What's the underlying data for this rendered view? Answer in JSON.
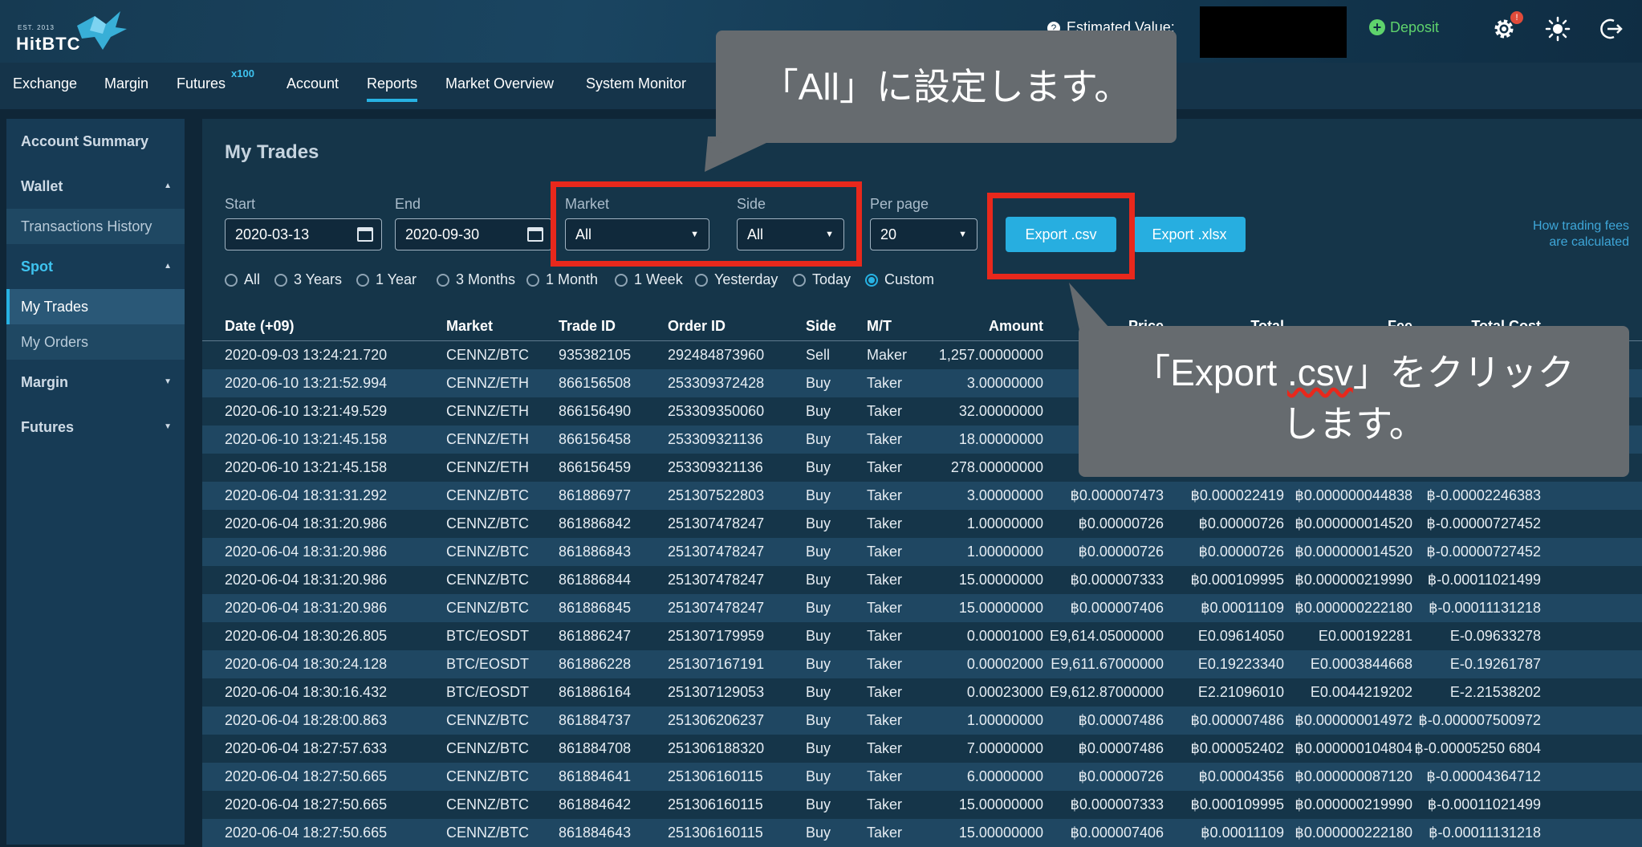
{
  "header": {
    "logo_est": "EST. 2013",
    "logo_name": "HitBTC",
    "estimated_value_label": "Estimated Value:",
    "deposit_label": "Deposit",
    "notification_count": "!",
    "icons": [
      "settings-icon",
      "theme-sun-icon",
      "logout-icon"
    ]
  },
  "nav": {
    "items": [
      "Exchange",
      "Margin",
      "Futures",
      "Account",
      "Reports",
      "Market Overview",
      "System Monitor"
    ],
    "futures_badge": "x100",
    "active": "Reports"
  },
  "sidebar": {
    "account_summary": "Account Summary",
    "wallet": "Wallet",
    "transactions_history": "Transactions History",
    "spot": "Spot",
    "my_trades": "My Trades",
    "my_orders": "My Orders",
    "margin": "Margin",
    "futures": "Futures"
  },
  "filters": {
    "title": "My Trades",
    "start_label": "Start",
    "start_value": "2020-03-13",
    "end_label": "End",
    "end_value": "2020-09-30",
    "market_label": "Market",
    "market_value": "All",
    "side_label": "Side",
    "side_value": "All",
    "per_page_label": "Per page",
    "per_page_value": "20",
    "export_csv": "Export .csv",
    "export_xlsx": "Export .xlsx",
    "fees_link_1": "How trading fees",
    "fees_link_2": "are calculated",
    "periods": [
      "All",
      "3 Years",
      "1 Year",
      "3 Months",
      "1 Month",
      "1 Week",
      "Yesterday",
      "Today",
      "Custom"
    ],
    "selected_period": "Custom"
  },
  "table": {
    "columns": [
      "Date (+09)",
      "Market",
      "Trade ID",
      "Order ID",
      "Side",
      "M/T",
      "Amount",
      "Price",
      "Total",
      "Fee",
      "Total Cost"
    ],
    "rows": [
      [
        "2020-09-03 13:24:21.720",
        "CENNZ/BTC",
        "935382105",
        "292484873960",
        "Sell",
        "Maker",
        "1,257.00000000",
        "",
        "",
        "",
        ""
      ],
      [
        "2020-06-10 13:21:52.994",
        "CENNZ/ETH",
        "866156508",
        "253309372428",
        "Buy",
        "Taker",
        "3.00000000",
        "",
        "",
        "",
        ""
      ],
      [
        "2020-06-10 13:21:49.529",
        "CENNZ/ETH",
        "866156490",
        "253309350060",
        "Buy",
        "Taker",
        "32.00000000",
        "",
        "",
        "",
        ""
      ],
      [
        "2020-06-10 13:21:45.158",
        "CENNZ/ETH",
        "866156458",
        "253309321136",
        "Buy",
        "Taker",
        "18.00000000",
        "",
        "",
        "",
        ""
      ],
      [
        "2020-06-10 13:21:45.158",
        "CENNZ/ETH",
        "866156459",
        "253309321136",
        "Buy",
        "Taker",
        "278.00000000",
        "",
        "",
        "",
        ""
      ],
      [
        "2020-06-04 18:31:31.292",
        "CENNZ/BTC",
        "861886977",
        "251307522803",
        "Buy",
        "Taker",
        "3.00000000",
        "฿0.000007473",
        "฿0.000022419",
        "฿0.000000044838",
        "฿-0.00002246383"
      ],
      [
        "2020-06-04 18:31:20.986",
        "CENNZ/BTC",
        "861886842",
        "251307478247",
        "Buy",
        "Taker",
        "1.00000000",
        "฿0.00000726",
        "฿0.00000726",
        "฿0.000000014520",
        "฿-0.00000727452"
      ],
      [
        "2020-06-04 18:31:20.986",
        "CENNZ/BTC",
        "861886843",
        "251307478247",
        "Buy",
        "Taker",
        "1.00000000",
        "฿0.00000726",
        "฿0.00000726",
        "฿0.000000014520",
        "฿-0.00000727452"
      ],
      [
        "2020-06-04 18:31:20.986",
        "CENNZ/BTC",
        "861886844",
        "251307478247",
        "Buy",
        "Taker",
        "15.00000000",
        "฿0.000007333",
        "฿0.000109995",
        "฿0.000000219990",
        "฿-0.00011021499"
      ],
      [
        "2020-06-04 18:31:20.986",
        "CENNZ/BTC",
        "861886845",
        "251307478247",
        "Buy",
        "Taker",
        "15.00000000",
        "฿0.000007406",
        "฿0.00011109",
        "฿0.000000222180",
        "฿-0.00011131218"
      ],
      [
        "2020-06-04 18:30:26.805",
        "BTC/EOSDT",
        "861886247",
        "251307179959",
        "Buy",
        "Taker",
        "0.00001000",
        "E9,614.05000000",
        "E0.09614050",
        "E0.000192281",
        "E-0.09633278"
      ],
      [
        "2020-06-04 18:30:24.128",
        "BTC/EOSDT",
        "861886228",
        "251307167191",
        "Buy",
        "Taker",
        "0.00002000",
        "E9,611.67000000",
        "E0.19223340",
        "E0.0003844668",
        "E-0.19261787"
      ],
      [
        "2020-06-04 18:30:16.432",
        "BTC/EOSDT",
        "861886164",
        "251307129053",
        "Buy",
        "Taker",
        "0.00023000",
        "E9,612.87000000",
        "E2.21096010",
        "E0.0044219202",
        "E-2.21538202"
      ],
      [
        "2020-06-04 18:28:00.863",
        "CENNZ/BTC",
        "861884737",
        "251306206237",
        "Buy",
        "Taker",
        "1.00000000",
        "฿0.00007486",
        "฿0.000007486",
        "฿0.000000014972",
        "฿-0.000007500972"
      ],
      [
        "2020-06-04 18:27:57.633",
        "CENNZ/BTC",
        "861884708",
        "251306188320",
        "Buy",
        "Taker",
        "7.00000000",
        "฿0.00007486",
        "฿0.000052402",
        "฿0.000000104804",
        "฿-0.00005250 6804"
      ],
      [
        "2020-06-04 18:27:50.665",
        "CENNZ/BTC",
        "861884641",
        "251306160115",
        "Buy",
        "Taker",
        "6.00000000",
        "฿0.00000726",
        "฿0.00004356",
        "฿0.000000087120",
        "฿-0.00004364712"
      ],
      [
        "2020-06-04 18:27:50.665",
        "CENNZ/BTC",
        "861884642",
        "251306160115",
        "Buy",
        "Taker",
        "15.00000000",
        "฿0.000007333",
        "฿0.000109995",
        "฿0.000000219990",
        "฿-0.00011021499"
      ],
      [
        "2020-06-04 18:27:50.665",
        "CENNZ/BTC",
        "861884643",
        "251306160115",
        "Buy",
        "Taker",
        "15.00000000",
        "฿0.000007406",
        "฿0.00011109",
        "฿0.000000222180",
        "฿-0.00011131218"
      ]
    ]
  },
  "annotations": {
    "callout_1": "「All」に設定します。",
    "callout_2_a": "「Export ",
    "callout_2_b": ".csv",
    "callout_2_c": "」をクリック",
    "callout_2_d": "します。",
    "highlight_color": "#e8281c"
  }
}
